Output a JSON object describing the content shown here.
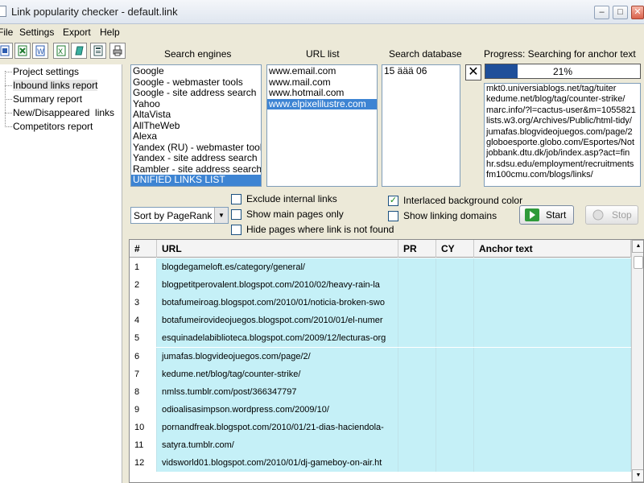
{
  "window": {
    "title": "Link popularity checker - default.link",
    "minimize_glyph": "–",
    "maximize_glyph": "□",
    "close_glyph": "✕"
  },
  "menu": [
    "File",
    "Settings",
    "Export",
    "Help"
  ],
  "toolbar": {
    "icons": [
      "export-word-icon",
      "export-excel-icon",
      "export-word-alt-icon",
      "export-excel-alt-icon",
      "export-notepad-icon",
      "export-report-icon",
      "print-icon"
    ]
  },
  "tree": {
    "items": [
      "Project settings",
      "Inbound links report",
      "Summary report",
      "New/Disappeared  links",
      "Competitors report"
    ],
    "selected_index": 1
  },
  "search_engines": {
    "label": "Search engines",
    "items": [
      "Google",
      "Google - webmaster tools",
      "Google - site address search",
      "Yahoo",
      "AltaVista",
      "AllTheWeb",
      "Alexa",
      "Yandex (RU) - webmaster tools",
      "Yandex - site address search",
      "Rambler - site address search",
      "UNIFIED LINKS LIST"
    ],
    "selected_index": 10
  },
  "url_list": {
    "label": "URL list",
    "items": [
      "www.email.com",
      "www.mail.com",
      "www.hotmail.com",
      "www.elpixelilustre.com"
    ],
    "selected_index": 3
  },
  "search_database": {
    "label": "Search database",
    "items": [
      "15 äää 06"
    ]
  },
  "progress": {
    "label": "Progress: Searching for anchor text",
    "percent_text": "21%",
    "fraction": 0.21,
    "fill_color": "#1f4f9a",
    "cancel_glyph": "✕",
    "log": [
      "mkt0.universiablogs.net/tag/tuiter",
      "kedume.net/blog/tag/counter-strike/",
      "marc.info/?l=cactus-user&m=1055821",
      "lists.w3.org/Archives/Public/html-tidy/",
      "jumafas.blogvideojuegos.com/page/2",
      "globoesporte.globo.com/Esportes/Not",
      "jobbank.dtu.dk/job/index.asp?act=fin",
      "hr.sdsu.edu/employment/recruitments",
      "fm100cmu.com/blogs/links/"
    ]
  },
  "options": {
    "sort_label": "Sort by PageRank",
    "exclude_internal": {
      "label": "Exclude internal links",
      "checked": false
    },
    "show_main_pages": {
      "label": "Show main pages only",
      "checked": false
    },
    "hide_pages_not_found": {
      "label": "Hide pages where link is not found",
      "checked": false
    },
    "interlaced_bg": {
      "label": "Interlaced background color",
      "checked": true
    },
    "show_linking_domains": {
      "label": "Show linking domains",
      "checked": false
    }
  },
  "buttons": {
    "start": "Start",
    "stop": "Stop"
  },
  "grid": {
    "columns": [
      "#",
      "URL",
      "PR",
      "CY",
      "Anchor text"
    ],
    "rows": [
      {
        "num": "1",
        "url": "blogdegameloft.es/category/general/",
        "pr": "",
        "cy": "",
        "anchor": ""
      },
      {
        "num": "2",
        "url": "blogpetitperovalent.blogspot.com/2010/02/heavy-rain-la",
        "pr": "",
        "cy": "",
        "anchor": ""
      },
      {
        "num": "3",
        "url": "botafumeiroag.blogspot.com/2010/01/noticia-broken-swo",
        "pr": "",
        "cy": "",
        "anchor": ""
      },
      {
        "num": "4",
        "url": "botafumeirovideojuegos.blogspot.com/2010/01/el-numer",
        "pr": "",
        "cy": "",
        "anchor": ""
      },
      {
        "num": "5",
        "url": "esquinadelabiblioteca.blogspot.com/2009/12/lecturas-org",
        "pr": "",
        "cy": "",
        "anchor": ""
      },
      {
        "num": "6",
        "url": "jumafas.blogvideojuegos.com/page/2/",
        "pr": "",
        "cy": "",
        "anchor": ""
      },
      {
        "num": "7",
        "url": "kedume.net/blog/tag/counter-strike/",
        "pr": "",
        "cy": "",
        "anchor": ""
      },
      {
        "num": "8",
        "url": "nmlss.tumblr.com/post/366347797",
        "pr": "",
        "cy": "",
        "anchor": ""
      },
      {
        "num": "9",
        "url": "odioalisasimpson.wordpress.com/2009/10/",
        "pr": "",
        "cy": "",
        "anchor": ""
      },
      {
        "num": "10",
        "url": "pornandfreak.blogspot.com/2010/01/21-dias-haciendola-",
        "pr": "",
        "cy": "",
        "anchor": ""
      },
      {
        "num": "11",
        "url": "satyra.tumblr.com/",
        "pr": "",
        "cy": "",
        "anchor": ""
      },
      {
        "num": "12",
        "url": "vidsworld01.blogspot.com/2010/01/dj-gameboy-on-air.ht",
        "pr": "",
        "cy": "",
        "anchor": ""
      }
    ],
    "row_color": "#c5f0f7"
  }
}
